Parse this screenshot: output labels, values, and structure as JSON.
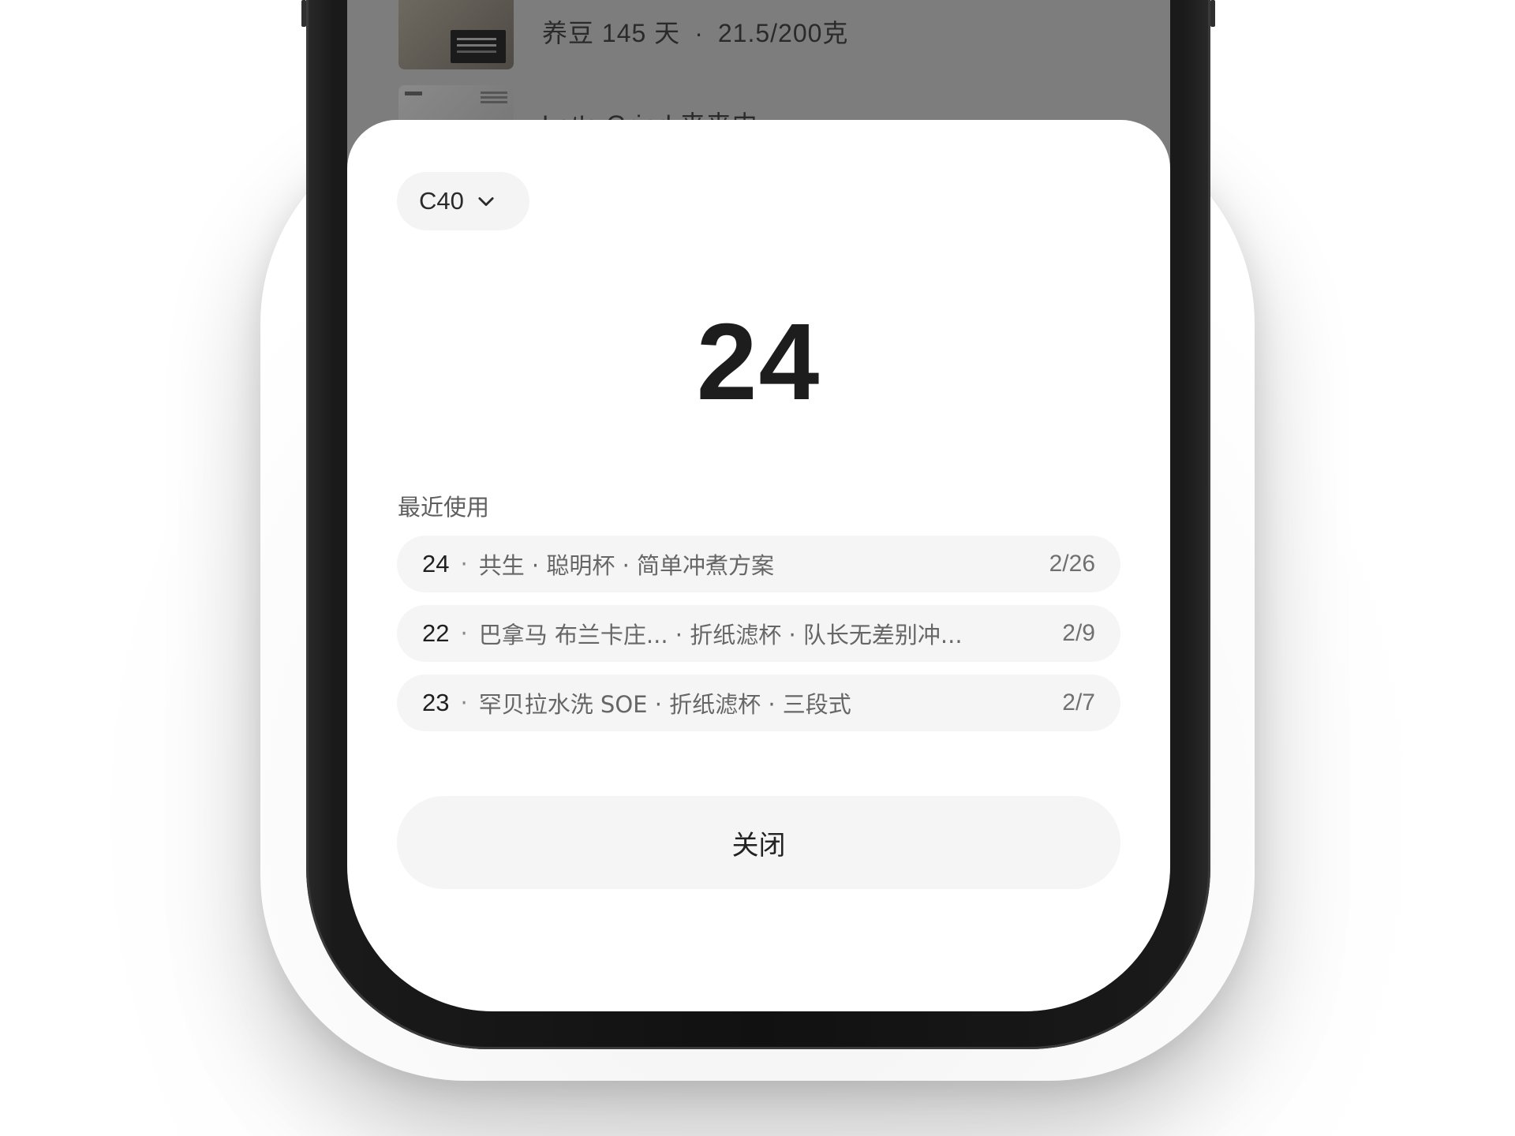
{
  "background": {
    "rows": [
      {
        "text_a": "养豆 145 天",
        "separator": "·",
        "text_b": "21.5/200克"
      },
      {
        "text_a": "Let's Grind 来来内"
      }
    ]
  },
  "sheet": {
    "grinder_selector": {
      "label": "C40",
      "icon": "chevron-down-icon"
    },
    "grind_value": "24",
    "recent_label": "最近使用",
    "recent_items": [
      {
        "setting": "24",
        "description": "共生 · 聪明杯 · 简单冲煮方案",
        "count": "2/26"
      },
      {
        "setting": "22",
        "description": "巴拿马 布兰卡庄... · 折纸滤杯 · 队长无差别冲...",
        "count": "2/9"
      },
      {
        "setting": "23",
        "description": "罕贝拉水洗 SOE · 折纸滤杯 · 三段式",
        "count": "2/7"
      }
    ],
    "close_label": "关闭"
  },
  "colors": {
    "overlay": "#7d7d7d",
    "sheet_bg": "#ffffff",
    "pill_bg": "#f5f5f5",
    "text_primary": "#1d1d1d"
  }
}
